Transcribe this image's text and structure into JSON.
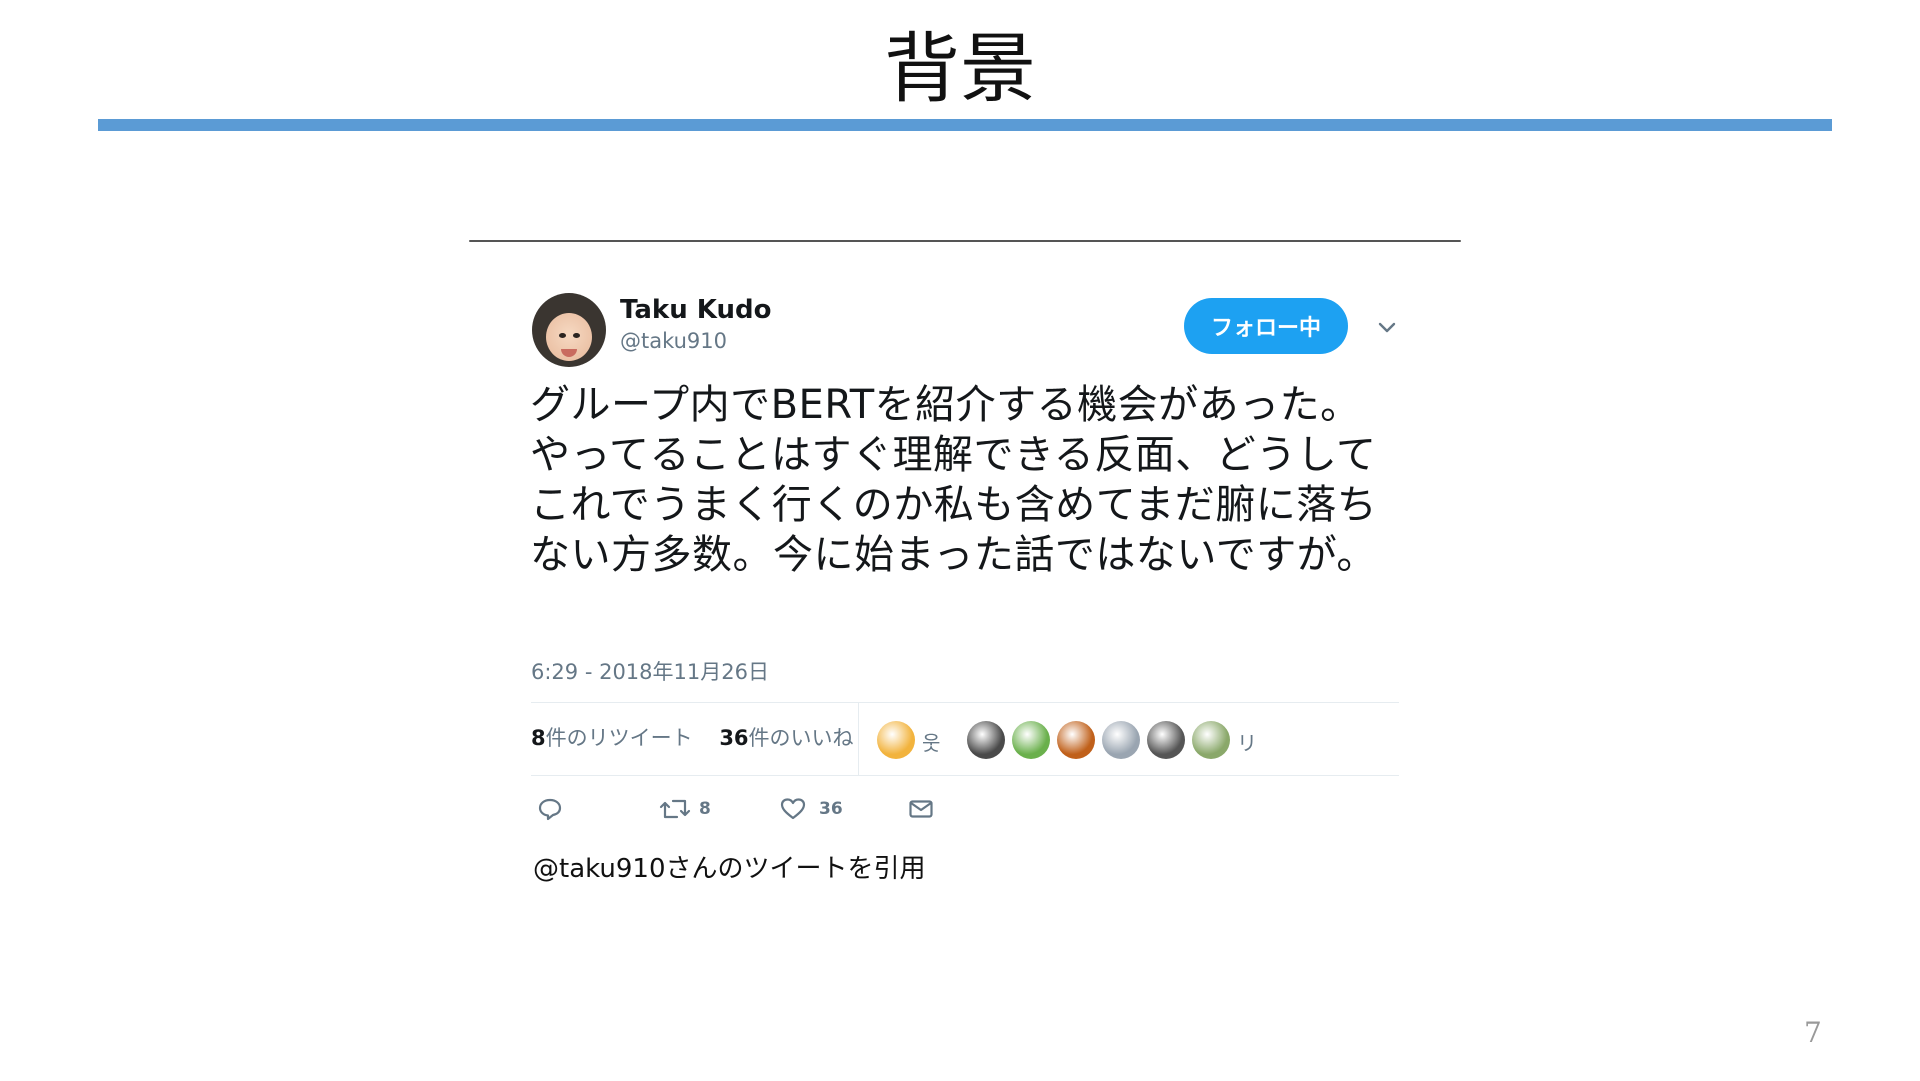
{
  "slide": {
    "title": "背景",
    "page_number": "7",
    "accent_color": "#5b9bd5"
  },
  "tweet": {
    "author_name": "Taku Kudo",
    "author_handle": "@taku910",
    "follow_button_label": "フォロー中",
    "text": "グループ内でBERTを紹介する機会があった。やってることはすぐ理解できる反面、どうしてこれでうまく行くのか私も含めてまだ腑に落ちない方多数。今に始まった話ではないですが。",
    "timestamp": "6:29 - 2018年11月26日",
    "retweets_count": "8",
    "retweets_label": "件のリツイート",
    "likes_count": "36",
    "likes_label": "件のいいね",
    "liker_avatars": [
      {
        "kind": "avatar",
        "color": "#f2b33d"
      },
      {
        "kind": "text",
        "text": "웃"
      },
      {
        "kind": "avatar",
        "color": "#4a4a4a"
      },
      {
        "kind": "avatar",
        "color": "#6ab04c"
      },
      {
        "kind": "avatar",
        "color": "#c0601a"
      },
      {
        "kind": "avatar",
        "color": "#9aa5b1"
      },
      {
        "kind": "avatar",
        "color": "#555555"
      },
      {
        "kind": "avatar",
        "color": "#8aa86a"
      },
      {
        "kind": "text",
        "text": "リ"
      }
    ],
    "actions": {
      "reply_icon": "reply-icon",
      "retweet_icon": "retweet-icon",
      "retweet_count": "8",
      "like_icon": "heart-icon",
      "like_count": "36",
      "dm_icon": "envelope-icon"
    },
    "brand_color": "#1da1f2"
  },
  "caption": "@taku910さんのツイートを引用"
}
